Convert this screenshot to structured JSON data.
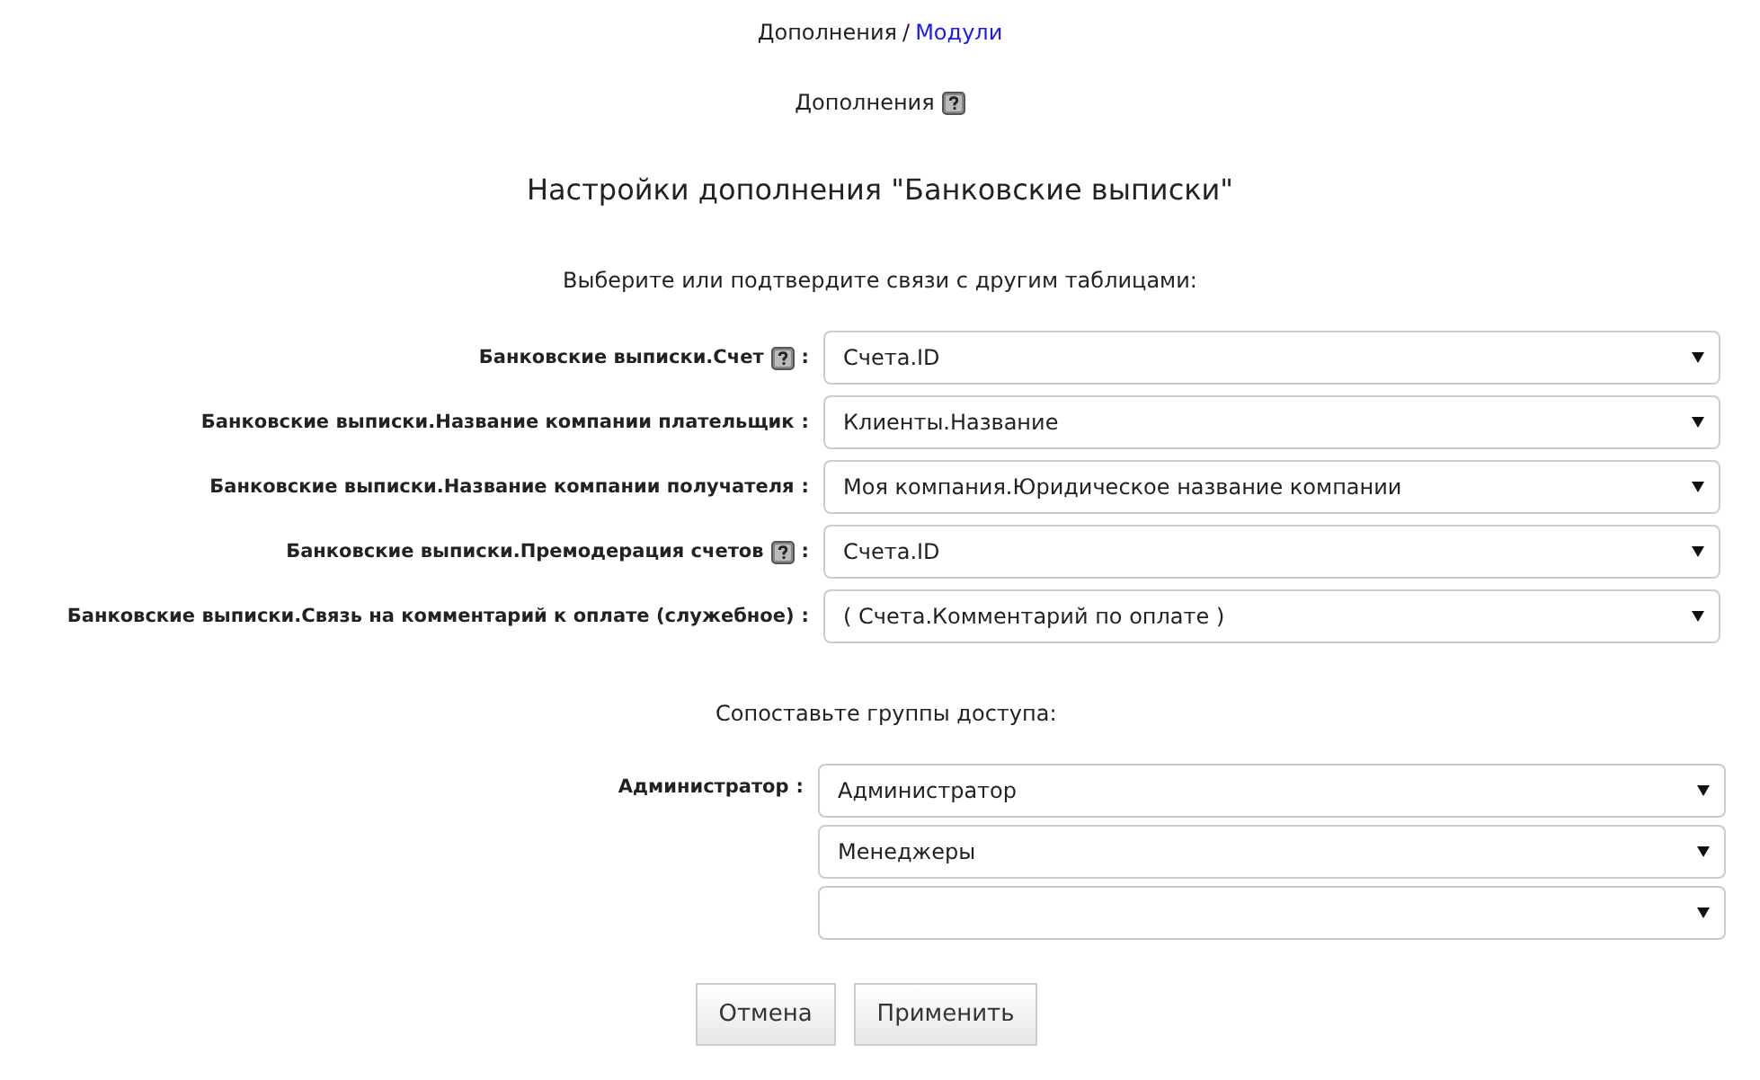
{
  "breadcrumb": {
    "parent": "Дополнения",
    "separator": "/",
    "current": "Модули"
  },
  "section": {
    "title": "Дополнения",
    "help": true
  },
  "heading": "Настройки дополнения \"Банковские выписки\"",
  "links_intro": "Выберите или подтвердите связи с другим таблицами:",
  "links": [
    {
      "label": "Банковские выписки.Счет",
      "help": true,
      "value": "Счета.ID"
    },
    {
      "label": "Банковские выписки.Название компании плательщик",
      "help": false,
      "value": "Клиенты.Название"
    },
    {
      "label": "Банковские выписки.Название компании получателя",
      "help": false,
      "value": "Моя компания.Юридическое название компании"
    },
    {
      "label": "Банковские выписки.Премодерация счетов",
      "help": true,
      "value": "Счета.ID"
    },
    {
      "label": "Банковские выписки.Связь на комментарий к оплате (служебное)",
      "help": false,
      "value": "( Счета.Комментарий по оплате )"
    }
  ],
  "colon": ":",
  "groups_intro": "Сопоставьте группы доступа:",
  "groups": [
    {
      "label": "Администратор",
      "selects": [
        {
          "kind": "filled",
          "value": "Администратор"
        },
        {
          "kind": "filled",
          "value": "Менеджеры"
        },
        {
          "kind": "blank"
        }
      ]
    }
  ],
  "buttons": [
    {
      "label": "Отмена"
    },
    {
      "label": "Применить"
    }
  ]
}
